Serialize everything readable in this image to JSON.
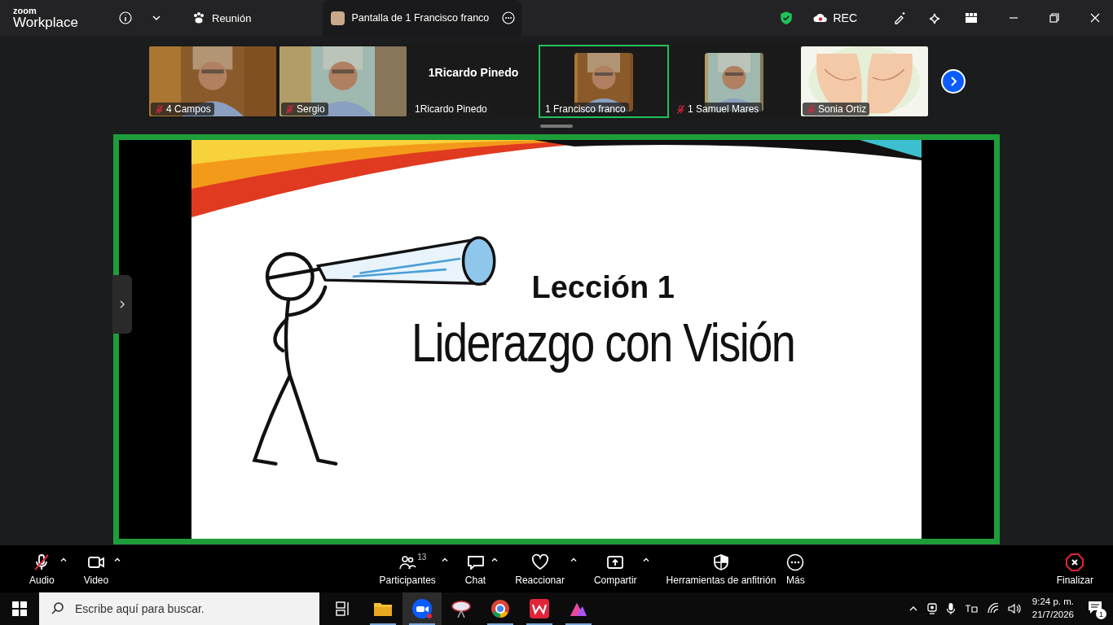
{
  "title_bar": {
    "logo_top": "zoom",
    "logo_bottom": "Workplace",
    "meeting_tab": "Reunión",
    "share_tab": "Pantalla de 1 Francisco franco",
    "rec_label": "REC"
  },
  "gallery": [
    {
      "name": "4 Campos",
      "kind": "video",
      "muted": true,
      "selected": false
    },
    {
      "name": "Sergio",
      "kind": "video",
      "muted": true,
      "selected": false
    },
    {
      "name": "1Ricardo Pinedo",
      "kind": "name",
      "display_name": "1Ricardo Pinedo",
      "muted": false,
      "selected": false
    },
    {
      "name": "1 Francisco franco",
      "muted": false,
      "selected": true
    },
    {
      "name": "1 Samuel Mares",
      "muted": true,
      "selected": false
    },
    {
      "name": "Sonia Ortiz",
      "kind": "video",
      "muted": true,
      "selected": false
    }
  ],
  "slide": {
    "heading": "Lección 1",
    "title": "Liderazgo con Visión"
  },
  "toolbar": [
    {
      "label": "Audio",
      "caret": true,
      "muted": true
    },
    {
      "label": "Video",
      "caret": true
    },
    {
      "label": "Participantes",
      "caret": true,
      "count": "13"
    },
    {
      "label": "Chat",
      "caret": true
    },
    {
      "label": "Reaccionar",
      "caret": true
    },
    {
      "label": "Compartir",
      "caret": true
    },
    {
      "label": "Herramientas de anfitrión",
      "caret": false
    },
    {
      "label": "Más",
      "caret": false
    }
  ],
  "end_button": "Finalizar",
  "taskbar": {
    "search_placeholder": "Escribe aquí para buscar.",
    "time": "9:24 p. m.",
    "date": "21/7/2026",
    "notifications": "1"
  }
}
